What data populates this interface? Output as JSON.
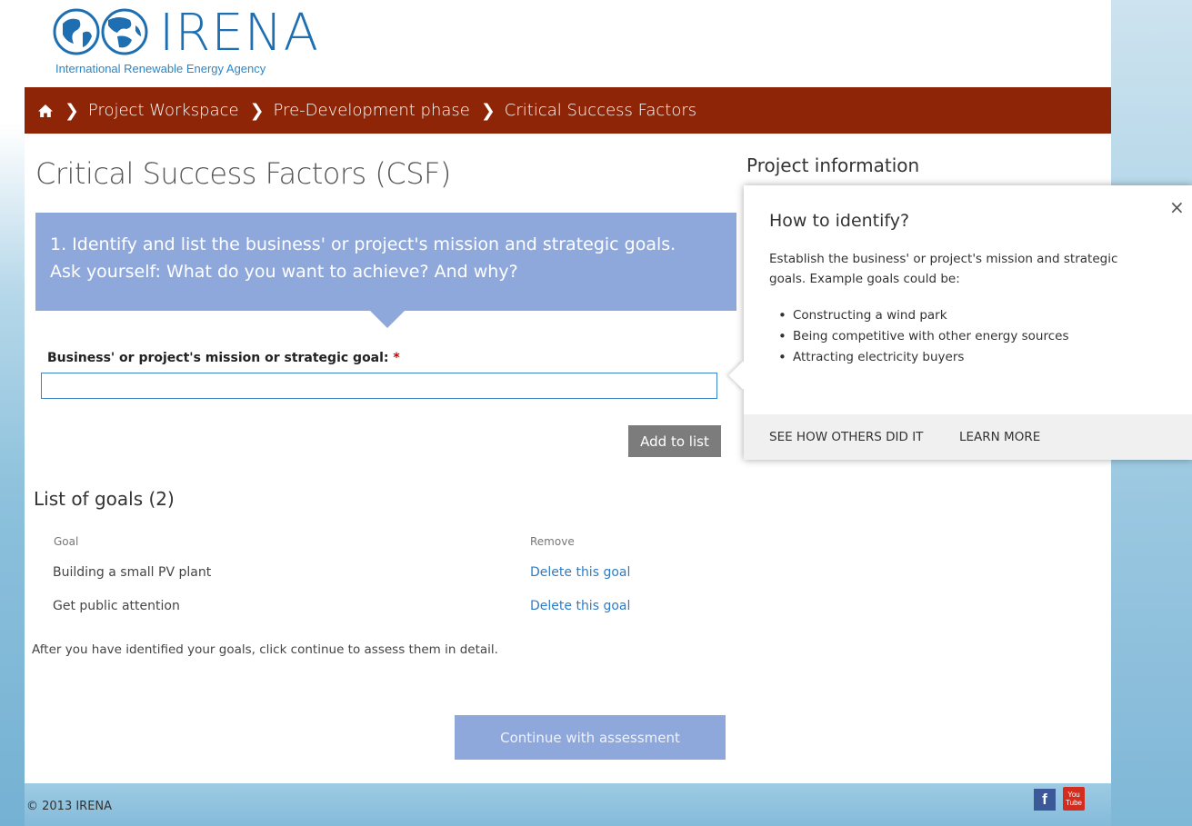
{
  "header": {
    "logo_word": "IRENA",
    "logo_tagline": "International Renewable Energy Agency"
  },
  "breadcrumb": {
    "items": [
      "Project Workspace",
      "Pre-Development phase",
      "Critical Success Factors"
    ]
  },
  "main": {
    "title": "Critical Success Factors (CSF)",
    "project_info": "Project information",
    "question_line1": "1. Identify and list the business' or project's mission and strategic goals.",
    "question_line2": "Ask yourself: What do you want to achieve? And why?",
    "field_label": "Business' or project's mission or strategic goal:",
    "required_mark": "*",
    "goal_input_value": "",
    "add_button": "Add to list",
    "list_title": "List of goals (2)",
    "columns": {
      "goal": "Goal",
      "remove": "Remove"
    },
    "goals": [
      {
        "goal": "Building a small PV plant",
        "action": "Delete this goal"
      },
      {
        "goal": "Get public attention",
        "action": "Delete this goal"
      }
    ],
    "hint": "After you have identified your goals, click continue to assess them in detail.",
    "continue_button": "Continue with assessment"
  },
  "popup": {
    "title": "How to identify?",
    "close": "×",
    "text": "Establish the business' or project's mission and strategic goals. Example goals could be:",
    "examples": [
      "Constructing a wind park",
      "Being competitive with other energy sources",
      "Attracting electricity buyers"
    ],
    "see_others": "SEE HOW OTHERS DID IT",
    "learn_more": "LEARN MORE"
  },
  "footer": {
    "copyright": "© 2013 IRENA",
    "facebook_glyph": "f",
    "youtube_top": "You",
    "youtube_bottom": "Tube"
  },
  "colors": {
    "breadcrumb_bg": "#8e2507",
    "accent_blue": "#8fa8dc",
    "link_blue": "#2d7cc7",
    "logo_blue": "#1d6fb2"
  }
}
